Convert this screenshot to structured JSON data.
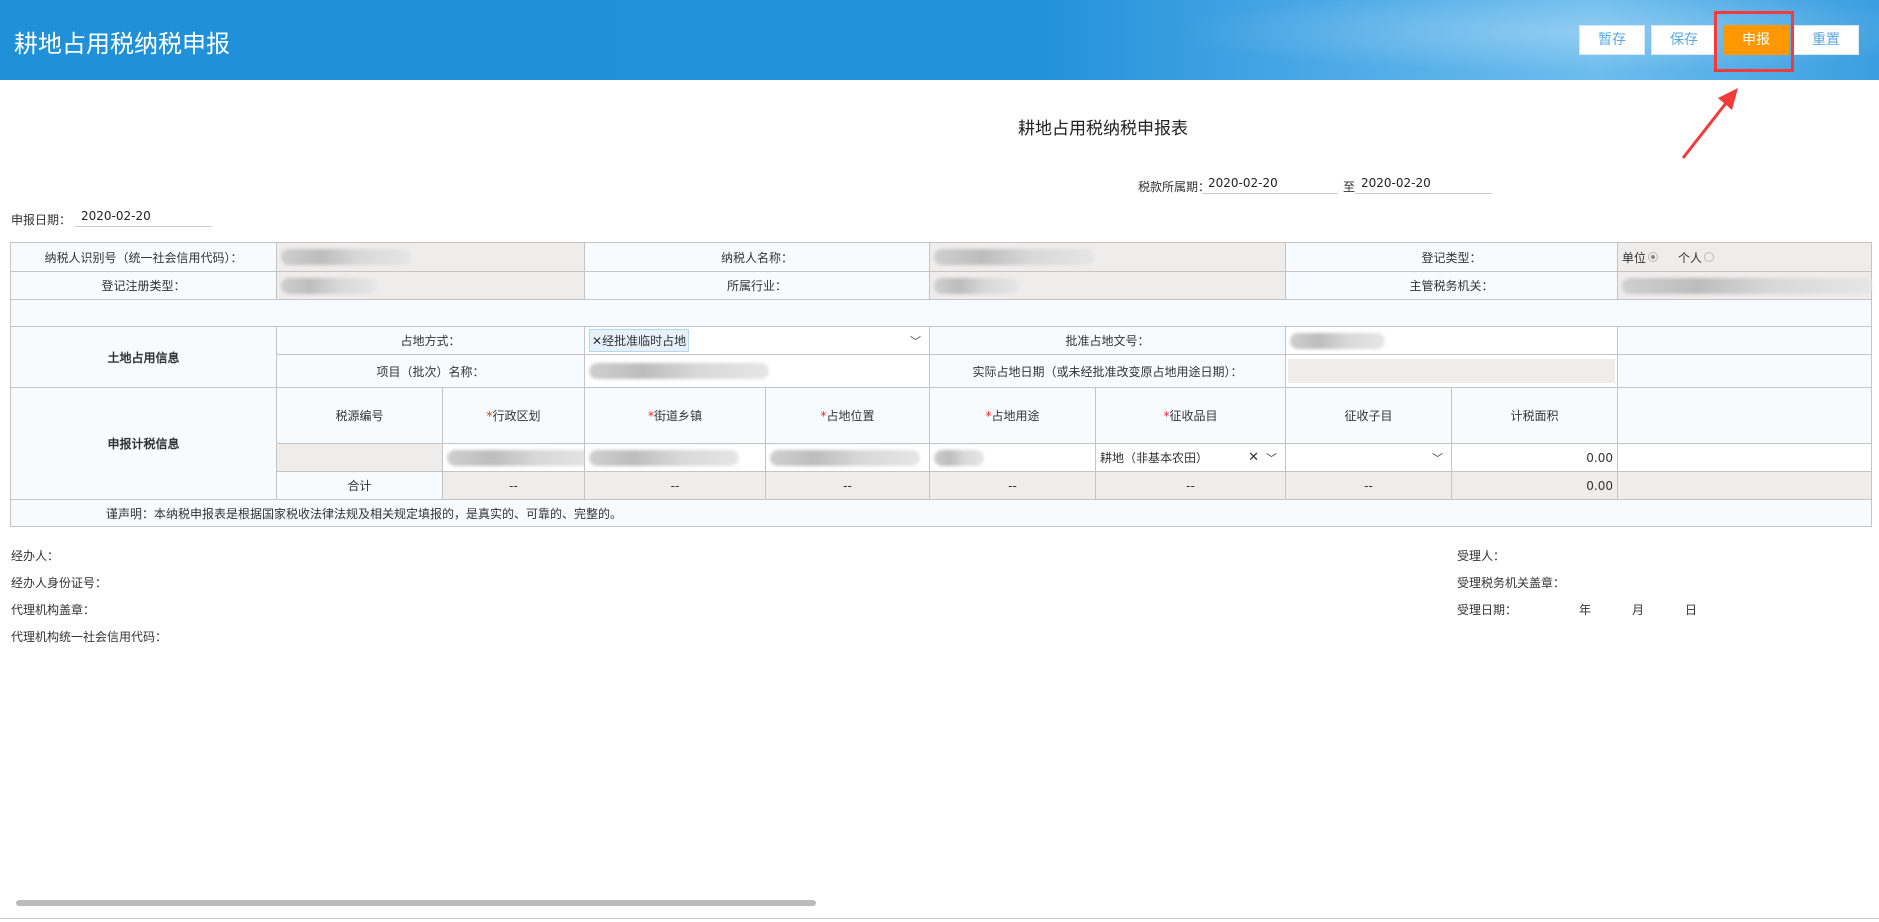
{
  "header": {
    "title": "耕地占用税纳税申报"
  },
  "toolbar": {
    "temp_save": "暂存",
    "save": "保存",
    "submit": "申报",
    "reset": "重置"
  },
  "accent": {
    "header_blue": "#2291d9",
    "submit_orange": "#ff9800",
    "highlight_red": "#f23b3b"
  },
  "form": {
    "title": "耕地占用税纳税申报表",
    "period_label": "税款所属期：",
    "period_from": "2020-02-20",
    "period_to_label": "至",
    "period_to": "2020-02-20",
    "declare_date_label": "申报日期：",
    "declare_date": "2020-02-20"
  },
  "table": {
    "taxpayer_id_label": "纳税人识别号（统一社会信用代码）：",
    "taxpayer_name_label": "纳税人名称：",
    "reg_type_label": "登记类型：",
    "reg_type_unit": "单位",
    "reg_type_person": "个人",
    "reg_reg_type_label": "登记注册类型：",
    "industry_label": "所属行业：",
    "tax_authority_label": "主管税务机关：",
    "land_section": "土地占用信息",
    "occupy_mode_label": "占地方式：",
    "occupy_mode_value": "经批准临时占地",
    "approval_doc_label": "批准占地文号：",
    "project_name_label": "项目（批次）名称：",
    "actual_date_label": "实际占地日期（或未经批准改变原占地用途日期）：",
    "calc_section": "申报计税信息",
    "columns": [
      "税源编号",
      "行政区划",
      "街道乡镇",
      "占地位置",
      "占地用途",
      "征收品目",
      "征收子目",
      "计税面积"
    ],
    "row": {
      "item": "耕地（非基本农田）",
      "area": "0.00"
    },
    "total": {
      "label": "合计",
      "dash": "--",
      "area": "0.00"
    },
    "declaration": "谨声明：本纳税申报表是根据国家税收法律法规及相关规定填报的，是真实的、可靠的、完整的。"
  },
  "footer": {
    "agent": "经办人：",
    "agent_id": "经办人身份证号：",
    "agency_seal": "代理机构盖章：",
    "agency_code": "代理机构统一社会信用代码：",
    "receiver": "受理人：",
    "receiver_seal": "受理税务机关盖章：",
    "receive_date": "受理日期：",
    "year": "年",
    "month": "月",
    "day": "日"
  }
}
